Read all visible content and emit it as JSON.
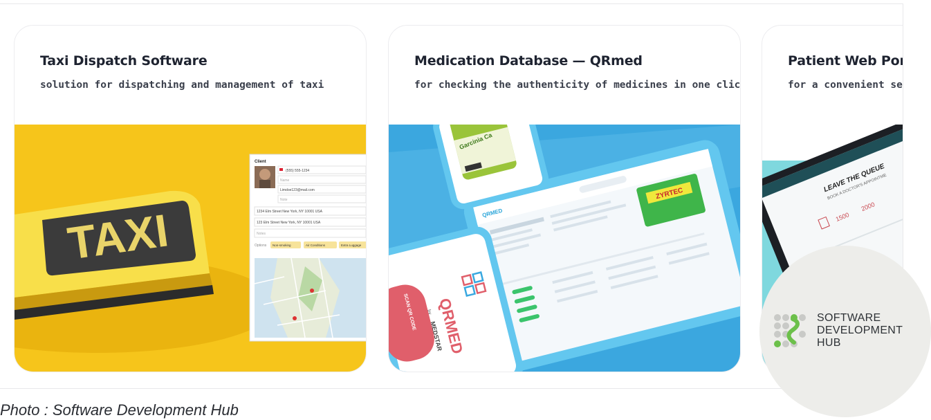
{
  "cards": [
    {
      "title": "Taxi Dispatch Software",
      "subtitle": "solution for dispatching and management of taxi"
    },
    {
      "title": "Medication Database — QRmed",
      "subtitle": "for checking the authenticity of medicines in one click."
    },
    {
      "title": "Patient Web Porta",
      "subtitle": "for a convenient searc"
    }
  ],
  "taxi_ui": {
    "sign_text": "TAXI",
    "section_label": "Client",
    "phone": "(555) 555-1234",
    "name_placeholder": "Name",
    "email": "Limdoe123@mail.com",
    "note_placeholder": "Note",
    "address1": "1234 Elm Street New York, NY 10001 USA",
    "address2": "123 Elm Street New York, NY 10001 USA",
    "notes_placeholder": "Notes",
    "options_label": "Options",
    "options": [
      "Non-smoking",
      "Air Conditions",
      "Extra Luggage"
    ]
  },
  "qrmed_ui": {
    "brand": "QRMED",
    "by": "by",
    "maker": "MEDSTAR",
    "scan_button": "SCAN QR CODE",
    "product": "ZYRTEC",
    "bottle": "Garcinia Ca"
  },
  "portal_ui": {
    "heading": "LEAVE THE QUEUE",
    "subheading": "BOOK A DOCTOR'S APPOINTME",
    "stats": [
      "1500",
      "2000"
    ]
  },
  "logo": {
    "lines": [
      "SOFTWARE",
      "DEVELOPMENT",
      "HUB"
    ]
  },
  "caption": "Photo : Software Development Hub",
  "colors": {
    "taxi_yellow": "#f5c419",
    "qrmed_blue": "#39a8e0",
    "portal_teal": "#7fd8de",
    "scan_red": "#e05f6b"
  }
}
